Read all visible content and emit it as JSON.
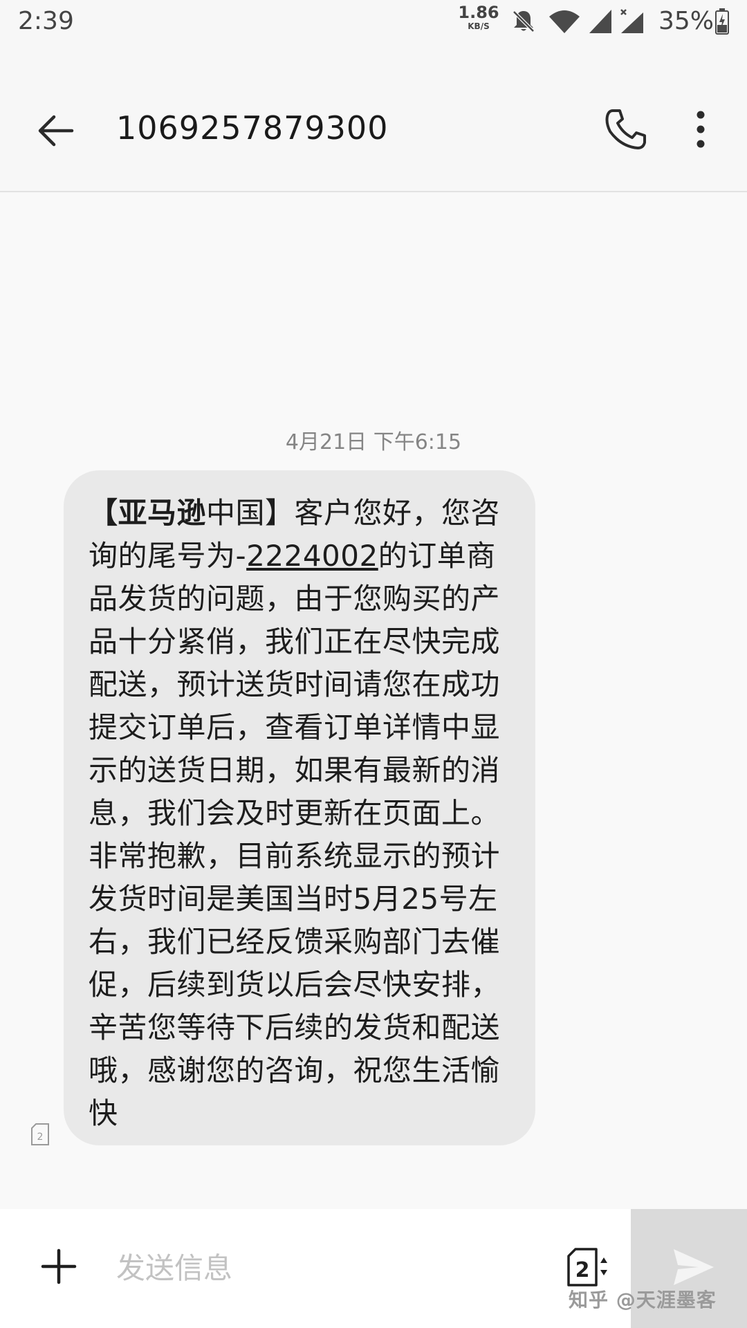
{
  "status_bar": {
    "time": "2:39",
    "net_speed_value": "1.86",
    "net_speed_unit": "KB/S",
    "battery_percent": "35%",
    "icons": [
      "notifications-off-icon",
      "wifi-icon",
      "signal-icon",
      "signal-no-data-icon",
      "battery-icon"
    ]
  },
  "header": {
    "title": "1069257879300",
    "icons": [
      "back-arrow-icon",
      "phone-icon",
      "more-vert-icon"
    ]
  },
  "conversation": {
    "timestamp": "4月21日 下午6:15",
    "message": {
      "bold_prefix": "【亚马逊",
      "line1_rest": "中国】客户您好，您咨",
      "line2_pre": "询的尾号为-",
      "order_number": "2224002",
      "line2_post": "的订单商",
      "lines": [
        "品发货的问题，由于您购买的产",
        "品十分紧俏，我们正在尽快完成",
        "配送，预计送货时间请您在成功",
        "提交订单后，查看订单详情中显",
        "示的送货日期，如果有最新的消",
        "息，我们会及时更新在页面上。",
        "非常抱歉，目前系统显示的预计",
        "发货时间是美国当时5月25号左",
        "右，我们已经反馈采购部门去催",
        "促，后续到货以后会尽快安排，",
        "辛苦您等待下后续的发货和配送",
        "哦，感谢您的咨询，祝您生活愉",
        "快"
      ],
      "sim_label": "2"
    }
  },
  "compose": {
    "placeholder": "发送信息",
    "value": "",
    "sim_slot": "2",
    "icons": [
      "add-icon",
      "sim-select-icon",
      "send-icon"
    ]
  },
  "watermark": "知乎 @天涯墨客"
}
